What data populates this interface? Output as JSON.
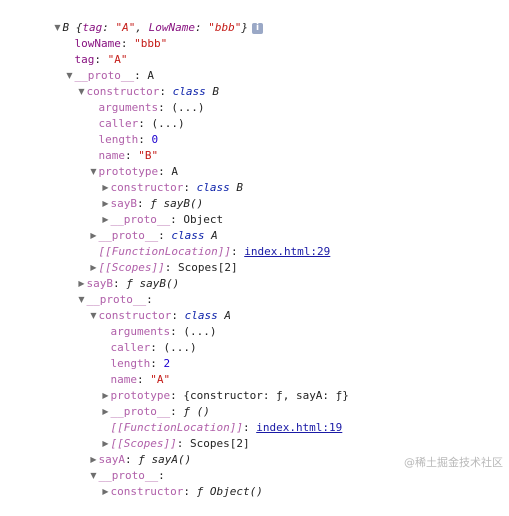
{
  "header": {
    "class_name": "B",
    "preview_open": "{",
    "tag_key": "tag",
    "tag_value": "\"A\"",
    "lowname_key": "LowName",
    "lowname_value": "\"bbb\"",
    "preview_close": "}",
    "info_glyph": "i"
  },
  "rows": {
    "r1_key": "lowName",
    "r1_val": "\"bbb\"",
    "r2_key": "tag",
    "r2_val": "\"A\"",
    "r3_key": "__proto__",
    "r3_val": "A",
    "r4_key": "constructor",
    "r4_kw": "class",
    "r4_val": "B",
    "r5_key": "arguments",
    "r5_val": "(...)",
    "r6_key": "caller",
    "r6_val": "(...)",
    "r7_key": "length",
    "r7_val": "0",
    "r8_key": "name",
    "r8_val": "\"B\"",
    "r9_key": "prototype",
    "r9_val": "A",
    "r10_key": "constructor",
    "r10_kw": "class",
    "r10_val": "B",
    "r11_key": "sayB",
    "r11_val": "ƒ sayB()",
    "r12_key": "__proto__",
    "r12_val": "Object",
    "r13_key": "__proto__",
    "r13_kw": "class",
    "r13_val": "A",
    "r14_key": "[[FunctionLocation]]",
    "r14_val": "index.html:29",
    "r15_key": "[[Scopes]]",
    "r15_val": "Scopes[2]",
    "r16_key": "sayB",
    "r16_val": "ƒ sayB()",
    "r17_key": "__proto__",
    "r18_key": "constructor",
    "r18_kw": "class",
    "r18_val": "A",
    "r19_key": "arguments",
    "r19_val": "(...)",
    "r20_key": "caller",
    "r20_val": "(...)",
    "r21_key": "length",
    "r21_val": "2",
    "r22_key": "name",
    "r22_val": "\"A\"",
    "r23_key": "prototype",
    "r23_val": "{constructor: ƒ, sayA: ƒ}",
    "r24_key": "__proto__",
    "r24_val": "ƒ ()",
    "r25_key": "[[FunctionLocation]]",
    "r25_val": "index.html:19",
    "r26_key": "[[Scopes]]",
    "r26_val": "Scopes[2]",
    "r27_key": "sayA",
    "r27_val": "ƒ sayA()",
    "r28_key": "__proto__",
    "r29_key": "constructor",
    "r29_val": "ƒ Object()"
  },
  "icons": {
    "expanded": "▼",
    "collapsed": "▶"
  },
  "watermark": "@稀土掘金技术社区"
}
